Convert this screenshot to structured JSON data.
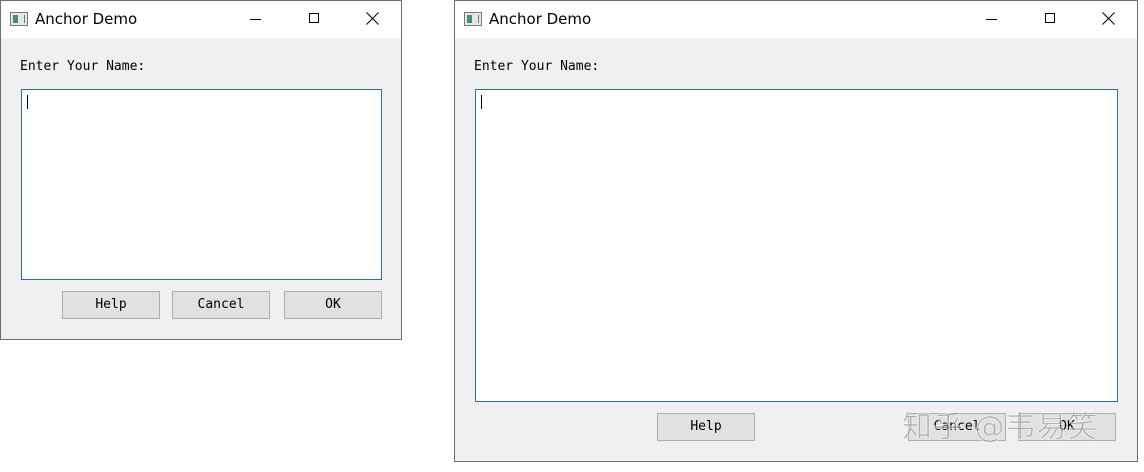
{
  "windows": [
    {
      "title": "Anchor Demo",
      "prompt_label": "Enter Your Name:",
      "name_value": "",
      "buttons": {
        "help": "Help",
        "cancel": "Cancel",
        "ok": "OK"
      }
    },
    {
      "title": "Anchor Demo",
      "prompt_label": "Enter Your Name:",
      "name_value": "",
      "buttons": {
        "help": "Help",
        "cancel": "Cancel",
        "ok": "OK"
      }
    }
  ],
  "watermark": "知乎 @韦易笑",
  "icons": [
    "app-icon",
    "minimize-icon",
    "maximize-icon",
    "close-icon"
  ]
}
